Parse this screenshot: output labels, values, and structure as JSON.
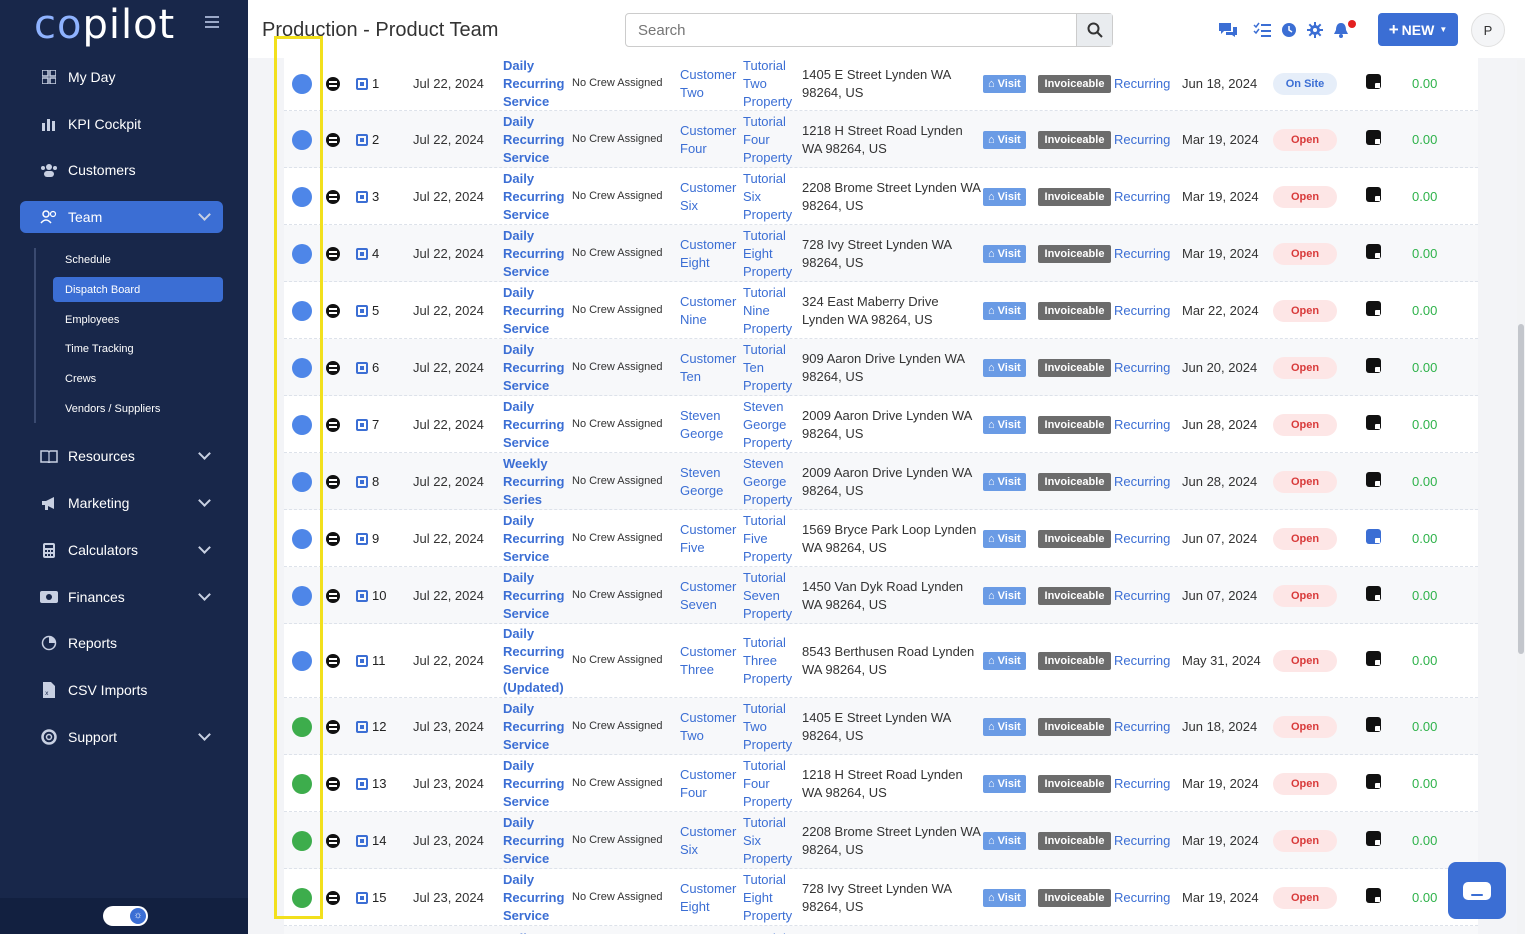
{
  "sidebar": {
    "logo_co": "co",
    "logo_rest": "pilot",
    "items": [
      {
        "label": "My Day",
        "icon": "grid-icon"
      },
      {
        "label": "KPI Cockpit",
        "icon": "bar-chart-icon"
      },
      {
        "label": "Customers",
        "icon": "users-icon"
      },
      {
        "label": "Team",
        "icon": "team-icon"
      },
      {
        "label": "Resources",
        "icon": "book-icon"
      },
      {
        "label": "Marketing",
        "icon": "megaphone-icon"
      },
      {
        "label": "Calculators",
        "icon": "calculator-icon"
      },
      {
        "label": "Finances",
        "icon": "money-icon"
      },
      {
        "label": "Reports",
        "icon": "pie-icon"
      },
      {
        "label": "CSV Imports",
        "icon": "file-icon"
      },
      {
        "label": "Support",
        "icon": "lifebuoy-icon"
      }
    ],
    "team_sub": [
      "Schedule",
      "Dispatch Board",
      "Employees",
      "Time Tracking",
      "Crews",
      "Vendors / Suppliers"
    ]
  },
  "header": {
    "title": "Production - Product Team",
    "search_placeholder": "Search",
    "new_label": "NEW",
    "avatar_initial": "P"
  },
  "rows": [
    {
      "num": "1",
      "date": "Jul 22, 2024",
      "service": "Daily Recurring Service",
      "crew": "No Crew Assigned",
      "customer": "Customer Two",
      "property": "Tutorial Two Property",
      "address": "1405 E Street Lynden WA 98264, US",
      "visit": "Visit",
      "invoice": "Invoiceable",
      "recur": "Recurring",
      "last": "Jun 18, 2024",
      "status": "On Site",
      "amount": "0.00",
      "dot": "blue"
    },
    {
      "num": "2",
      "date": "Jul 22, 2024",
      "service": "Daily Recurring Service",
      "crew": "No Crew Assigned",
      "customer": "Customer Four",
      "property": "Tutorial Four Property",
      "address": "1218 H Street Road Lynden WA 98264, US",
      "visit": "Visit",
      "invoice": "Invoiceable",
      "recur": "Recurring",
      "last": "Mar 19, 2024",
      "status": "Open",
      "amount": "0.00",
      "dot": "blue"
    },
    {
      "num": "3",
      "date": "Jul 22, 2024",
      "service": "Daily Recurring Service",
      "crew": "No Crew Assigned",
      "customer": "Customer Six",
      "property": "Tutorial Six Property",
      "address": "2208 Brome Street Lynden WA 98264, US",
      "visit": "Visit",
      "invoice": "Invoiceable",
      "recur": "Recurring",
      "last": "Mar 19, 2024",
      "status": "Open",
      "amount": "0.00",
      "dot": "blue"
    },
    {
      "num": "4",
      "date": "Jul 22, 2024",
      "service": "Daily Recurring Service",
      "crew": "No Crew Assigned",
      "customer": "Customer Eight",
      "property": "Tutorial Eight Property",
      "address": "728 Ivy Street Lynden WA 98264, US",
      "visit": "Visit",
      "invoice": "Invoiceable",
      "recur": "Recurring",
      "last": "Mar 19, 2024",
      "status": "Open",
      "amount": "0.00",
      "dot": "blue"
    },
    {
      "num": "5",
      "date": "Jul 22, 2024",
      "service": "Daily Recurring Service",
      "crew": "No Crew Assigned",
      "customer": "Customer Nine",
      "property": "Tutorial Nine Property",
      "address": "324 East Maberry Drive Lynden WA 98264, US",
      "visit": "Visit",
      "invoice": "Invoiceable",
      "recur": "Recurring",
      "last": "Mar 22, 2024",
      "status": "Open",
      "amount": "0.00",
      "dot": "blue"
    },
    {
      "num": "6",
      "date": "Jul 22, 2024",
      "service": "Daily Recurring Service",
      "crew": "No Crew Assigned",
      "customer": "Customer Ten",
      "property": "Tutorial Ten Property",
      "address": "909 Aaron Drive Lynden WA 98264, US",
      "visit": "Visit",
      "invoice": "Invoiceable",
      "recur": "Recurring",
      "last": "Jun 20, 2024",
      "status": "Open",
      "amount": "0.00",
      "dot": "blue"
    },
    {
      "num": "7",
      "date": "Jul 22, 2024",
      "service": "Daily Recurring Service",
      "crew": "No Crew Assigned",
      "customer": "Steven George",
      "property": "Steven George Property",
      "address": "2009 Aaron Drive Lynden WA 98264, US",
      "visit": "Visit",
      "invoice": "Invoiceable",
      "recur": "Recurring",
      "last": "Jun 28, 2024",
      "status": "Open",
      "amount": "0.00",
      "dot": "blue"
    },
    {
      "num": "8",
      "date": "Jul 22, 2024",
      "service": "Weekly Recurring Series",
      "crew": "No Crew Assigned",
      "customer": "Steven George",
      "property": "Steven George Property",
      "address": "2009 Aaron Drive Lynden WA 98264, US",
      "visit": "Visit",
      "invoice": "Invoiceable",
      "recur": "Recurring",
      "last": "Jun 28, 2024",
      "status": "Open",
      "amount": "0.00",
      "dot": "blue"
    },
    {
      "num": "9",
      "date": "Jul 22, 2024",
      "service": "Daily Recurring Service",
      "crew": "No Crew Assigned",
      "customer": "Customer Five",
      "property": "Tutorial Five Property",
      "address": "1569 Bryce Park Loop Lynden WA 98264, US",
      "visit": "Visit",
      "invoice": "Invoiceable",
      "recur": "Recurring",
      "last": "Jun 07, 2024",
      "status": "Open",
      "amount": "0.00",
      "dot": "blue",
      "note_blue": true
    },
    {
      "num": "10",
      "date": "Jul 22, 2024",
      "service": "Daily Recurring Service",
      "crew": "No Crew Assigned",
      "customer": "Customer Seven",
      "property": "Tutorial Seven Property",
      "address": "1450 Van Dyk Road Lynden WA 98264, US",
      "visit": "Visit",
      "invoice": "Invoiceable",
      "recur": "Recurring",
      "last": "Jun 07, 2024",
      "status": "Open",
      "amount": "0.00",
      "dot": "blue"
    },
    {
      "num": "11",
      "date": "Jul 22, 2024",
      "service": "Daily Recurring Service (Updated)",
      "crew": "No Crew Assigned",
      "customer": "Customer Three",
      "property": "Tutorial Three Property",
      "address": "8543 Berthusen Road Lynden WA 98264, US",
      "visit": "Visit",
      "invoice": "Invoiceable",
      "recur": "Recurring",
      "last": "May 31, 2024",
      "status": "Open",
      "amount": "0.00",
      "dot": "blue"
    },
    {
      "num": "12",
      "date": "Jul 23, 2024",
      "service": "Daily Recurring Service",
      "crew": "No Crew Assigned",
      "customer": "Customer Two",
      "property": "Tutorial Two Property",
      "address": "1405 E Street Lynden WA 98264, US",
      "visit": "Visit",
      "invoice": "Invoiceable",
      "recur": "Recurring",
      "last": "Jun 18, 2024",
      "status": "Open",
      "amount": "0.00",
      "dot": "green"
    },
    {
      "num": "13",
      "date": "Jul 23, 2024",
      "service": "Daily Recurring Service",
      "crew": "No Crew Assigned",
      "customer": "Customer Four",
      "property": "Tutorial Four Property",
      "address": "1218 H Street Road Lynden WA 98264, US",
      "visit": "Visit",
      "invoice": "Invoiceable",
      "recur": "Recurring",
      "last": "Mar 19, 2024",
      "status": "Open",
      "amount": "0.00",
      "dot": "green"
    },
    {
      "num": "14",
      "date": "Jul 23, 2024",
      "service": "Daily Recurring Service",
      "crew": "No Crew Assigned",
      "customer": "Customer Six",
      "property": "Tutorial Six Property",
      "address": "2208 Brome Street Lynden WA 98264, US",
      "visit": "Visit",
      "invoice": "Invoiceable",
      "recur": "Recurring",
      "last": "Mar 19, 2024",
      "status": "Open",
      "amount": "0.00",
      "dot": "green"
    },
    {
      "num": "15",
      "date": "Jul 23, 2024",
      "service": "Daily Recurring Service",
      "crew": "No Crew Assigned",
      "customer": "Customer Eight",
      "property": "Tutorial Eight Property",
      "address": "728 Ivy Street Lynden WA 98264, US",
      "visit": "Visit",
      "invoice": "Invoiceable",
      "recur": "Recurring",
      "last": "Mar 19, 2024",
      "status": "Open",
      "amount": "0.00",
      "dot": "green"
    },
    {
      "num": "",
      "date": "",
      "service": "Daily",
      "crew": "",
      "customer": "",
      "property": "Tutorial",
      "address": "",
      "visit": "",
      "invoice": "",
      "recur": "",
      "last": "",
      "status": "",
      "amount": "",
      "dot": "",
      "partial": true
    }
  ],
  "colors": {
    "accent": "#3b6ed4",
    "sidebar": "#18274a",
    "highlight": "#f2e01d",
    "amount": "#2eb24a",
    "open": "#d83a3a"
  }
}
